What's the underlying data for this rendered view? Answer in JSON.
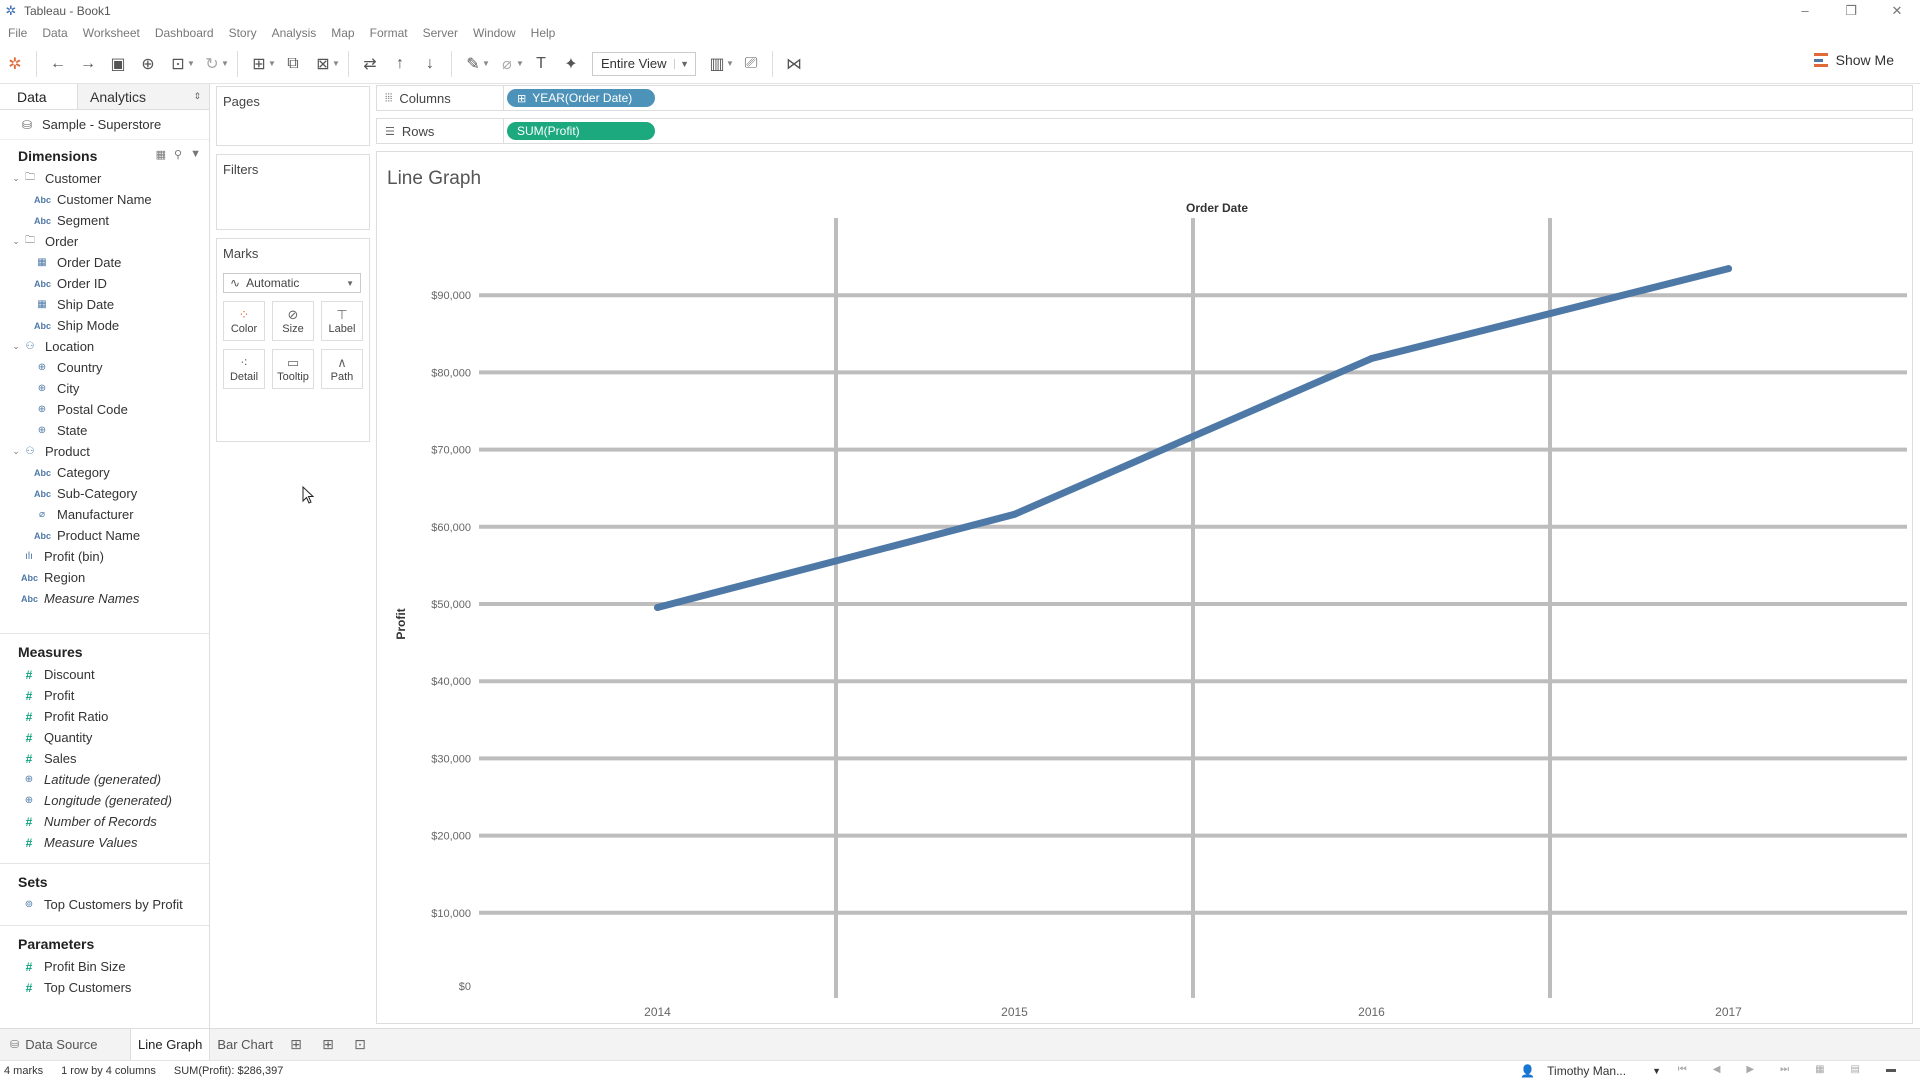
{
  "window": {
    "title": "Tableau - Book1"
  },
  "menu": [
    "File",
    "Data",
    "Worksheet",
    "Dashboard",
    "Story",
    "Analysis",
    "Map",
    "Format",
    "Server",
    "Window",
    "Help"
  ],
  "toolbar": {
    "fit_value": "Entire View",
    "show_me": "Show Me"
  },
  "data_pane": {
    "tab_data": "Data",
    "tab_analytics": "Analytics",
    "source": "Sample - Superstore",
    "dimensions_title": "Dimensions",
    "dimensions": [
      {
        "label": "Customer",
        "type": "folder",
        "level": 0
      },
      {
        "label": "Customer Name",
        "type": "abc",
        "level": 1
      },
      {
        "label": "Segment",
        "type": "abc",
        "level": 1
      },
      {
        "label": "Order",
        "type": "folder",
        "level": 0
      },
      {
        "label": "Order Date",
        "type": "date",
        "level": 1
      },
      {
        "label": "Order ID",
        "type": "abc",
        "level": 1
      },
      {
        "label": "Ship Date",
        "type": "date",
        "level": 1
      },
      {
        "label": "Ship Mode",
        "type": "abc",
        "level": 1
      },
      {
        "label": "Location",
        "type": "hier",
        "level": 0
      },
      {
        "label": "Country",
        "type": "geo",
        "level": 1
      },
      {
        "label": "City",
        "type": "geo",
        "level": 1
      },
      {
        "label": "Postal Code",
        "type": "geo",
        "level": 1
      },
      {
        "label": "State",
        "type": "geo",
        "level": 1
      },
      {
        "label": "Product",
        "type": "hier",
        "level": 0
      },
      {
        "label": "Category",
        "type": "abc",
        "level": 1
      },
      {
        "label": "Sub-Category",
        "type": "abc",
        "level": 1
      },
      {
        "label": "Manufacturer",
        "type": "clip",
        "level": 1
      },
      {
        "label": "Product Name",
        "type": "abc",
        "level": 1
      },
      {
        "label": "Profit (bin)",
        "type": "bin",
        "level": 2
      },
      {
        "label": "Region",
        "type": "abc",
        "level": 2
      },
      {
        "label": "Measure Names",
        "type": "abc",
        "level": 2,
        "italic": true
      }
    ],
    "measures_title": "Measures",
    "measures": [
      {
        "label": "Discount",
        "type": "meas"
      },
      {
        "label": "Profit",
        "type": "meas"
      },
      {
        "label": "Profit Ratio",
        "type": "meas"
      },
      {
        "label": "Quantity",
        "type": "meas"
      },
      {
        "label": "Sales",
        "type": "meas"
      },
      {
        "label": "Latitude (generated)",
        "type": "geo",
        "italic": true
      },
      {
        "label": "Longitude (generated)",
        "type": "geo",
        "italic": true
      },
      {
        "label": "Number of Records",
        "type": "meas",
        "italic": true
      },
      {
        "label": "Measure Values",
        "type": "meas",
        "italic": true
      }
    ],
    "sets_title": "Sets",
    "sets": [
      {
        "label": "Top Customers by Profit",
        "type": "set"
      }
    ],
    "parameters_title": "Parameters",
    "parameters": [
      {
        "label": "Profit Bin Size",
        "type": "meas"
      },
      {
        "label": "Top Customers",
        "type": "meas"
      }
    ]
  },
  "cards": {
    "pages": "Pages",
    "filters": "Filters",
    "marks": "Marks",
    "marks_type": "Automatic",
    "mark_buttons": [
      "Color",
      "Size",
      "Label",
      "Detail",
      "Tooltip",
      "Path"
    ]
  },
  "shelves": {
    "columns_label": "Columns",
    "columns_pill": "YEAR(Order Date)",
    "rows_label": "Rows",
    "rows_pill": "SUM(Profit)"
  },
  "chart_data": {
    "type": "line",
    "title": "Line Graph",
    "xlabel": "Order Date",
    "ylabel": "Profit",
    "categories": [
      "2014",
      "2015",
      "2016",
      "2017"
    ],
    "values": [
      49544,
      61619,
      81795,
      93439
    ],
    "ylim": [
      0,
      100000
    ],
    "yticks": [
      "$0",
      "$10,000",
      "$20,000",
      "$30,000",
      "$40,000",
      "$50,000",
      "$60,000",
      "$70,000",
      "$80,000",
      "$90,000"
    ],
    "line_color": "#4e79a7",
    "grid": true
  },
  "bottom_tabs": {
    "data_source": "Data Source",
    "sheets": [
      "Line Graph",
      "Bar Chart"
    ]
  },
  "status": {
    "marks": "4 marks",
    "rows_cols": "1 row by 4 columns",
    "sum": "SUM(Profit): $286,397",
    "user": "Timothy Man..."
  }
}
